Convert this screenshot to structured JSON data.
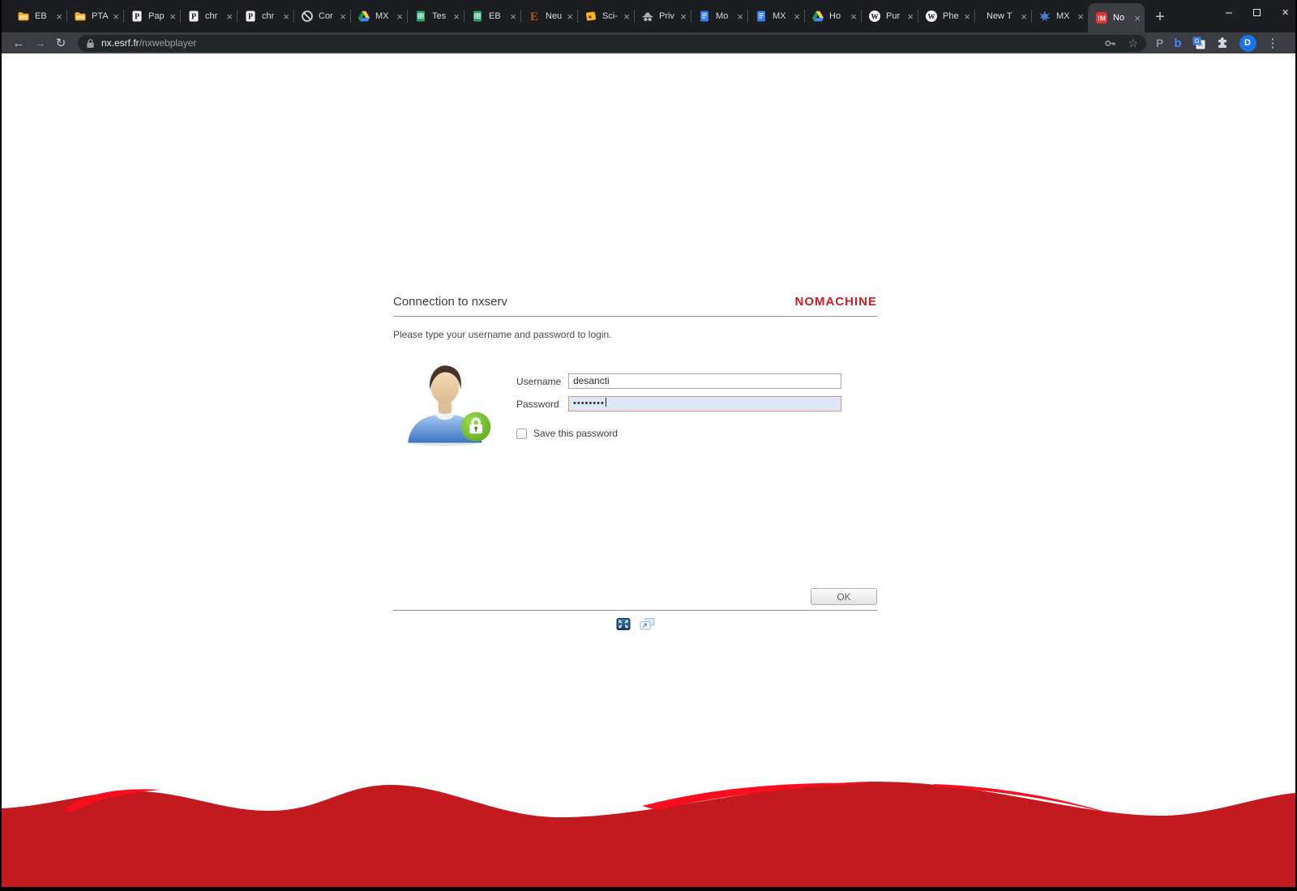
{
  "browser": {
    "tabs": [
      {
        "label": "EB",
        "icon": "folder",
        "active": false
      },
      {
        "label": "PTA",
        "icon": "folder",
        "active": false
      },
      {
        "label": "Pap",
        "icon": "paper",
        "active": false
      },
      {
        "label": "chr",
        "icon": "paper",
        "active": false
      },
      {
        "label": "chr",
        "icon": "paper",
        "active": false
      },
      {
        "label": "Cor",
        "icon": "slash",
        "active": false
      },
      {
        "label": "MX",
        "icon": "drive",
        "active": false
      },
      {
        "label": "Tes",
        "icon": "sheets",
        "active": false
      },
      {
        "label": "EB",
        "icon": "sheets",
        "active": false
      },
      {
        "label": "Neu",
        "icon": "endnote",
        "active": false
      },
      {
        "label": "Sci-",
        "icon": "note",
        "active": false
      },
      {
        "label": "Priv",
        "icon": "incognito",
        "active": false
      },
      {
        "label": "Mo",
        "icon": "docs",
        "active": false
      },
      {
        "label": "MX",
        "icon": "docs",
        "active": false
      },
      {
        "label": "Ho",
        "icon": "drive",
        "active": false
      },
      {
        "label": "Pur",
        "icon": "wikipedia",
        "active": false
      },
      {
        "label": "Phe",
        "icon": "wikipedia",
        "active": false
      },
      {
        "label": "New T",
        "icon": "none",
        "active": false
      },
      {
        "label": "MX",
        "icon": "flower",
        "active": false
      },
      {
        "label": "No",
        "icon": "nomachine",
        "active": true
      }
    ],
    "glyphs": {
      "close_tab": "×",
      "new_tab": "+",
      "back": "←",
      "forward": "→",
      "reload": "↻",
      "menu": "⋮",
      "star": "☆",
      "minimize": "–",
      "close_window": "×"
    },
    "url": {
      "domain": "nx.esrf.fr",
      "path": "/nxwebplayer"
    },
    "extensions": {
      "pocket_letter": "P",
      "b_letter": "b",
      "profile_initial": "D"
    }
  },
  "page": {
    "title": "Connection to nxserv",
    "brand": "NOMACHINE",
    "instruction": "Please type your username and password to login.",
    "form": {
      "username_label": "Username",
      "username_value": "desancti",
      "password_label": "Password",
      "password_value": "••••••••",
      "save_password_label": "Save this password",
      "ok_label": "OK"
    },
    "footer_icon_names": [
      "fullscreen-icon",
      "display-settings-icon"
    ],
    "colors": {
      "brand_red": "#d31a20",
      "wave_red": "#c31a1f",
      "wave_highlight": "#fa0d1e",
      "password_field_bg": "#dfe6f5",
      "password_field_border": "#d29287"
    }
  }
}
